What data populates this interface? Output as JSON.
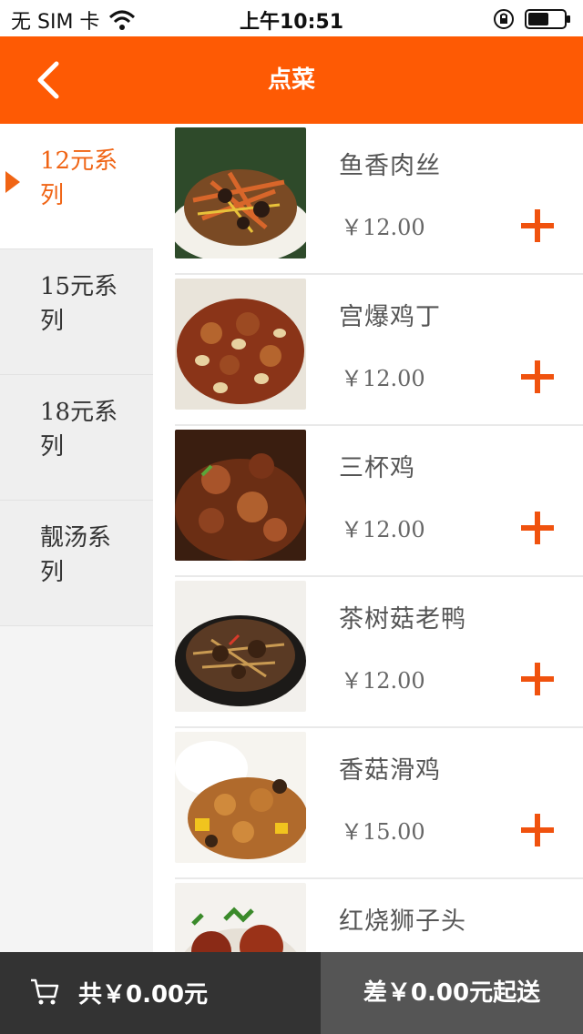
{
  "status_bar": {
    "carrier": "无 SIM 卡",
    "time": "上午10:51"
  },
  "navbar": {
    "title": "点菜",
    "back_icon": "chevron-left-icon"
  },
  "categories": [
    {
      "label": "12元系列",
      "active": true
    },
    {
      "label": "15元系列",
      "active": false
    },
    {
      "label": "18元系列",
      "active": false
    },
    {
      "label": "靓汤系列",
      "active": false
    }
  ],
  "dishes": [
    {
      "name": "鱼香肉丝",
      "price": "￥12.00"
    },
    {
      "name": "宫爆鸡丁",
      "price": "￥12.00"
    },
    {
      "name": "三杯鸡",
      "price": "￥12.00"
    },
    {
      "name": "茶树菇老鸭",
      "price": "￥12.00"
    },
    {
      "name": "香菇滑鸡",
      "price": "￥15.00"
    },
    {
      "name": "红烧狮子头",
      "price": ""
    }
  ],
  "footer": {
    "cart_total": "共￥0.00元",
    "min_order": "差￥0.00元起送",
    "cart_icon": "cart-icon"
  },
  "colors": {
    "accent": "#fe5a04",
    "add": "#f0520e",
    "footer_left": "#333333",
    "footer_right": "#555555"
  }
}
